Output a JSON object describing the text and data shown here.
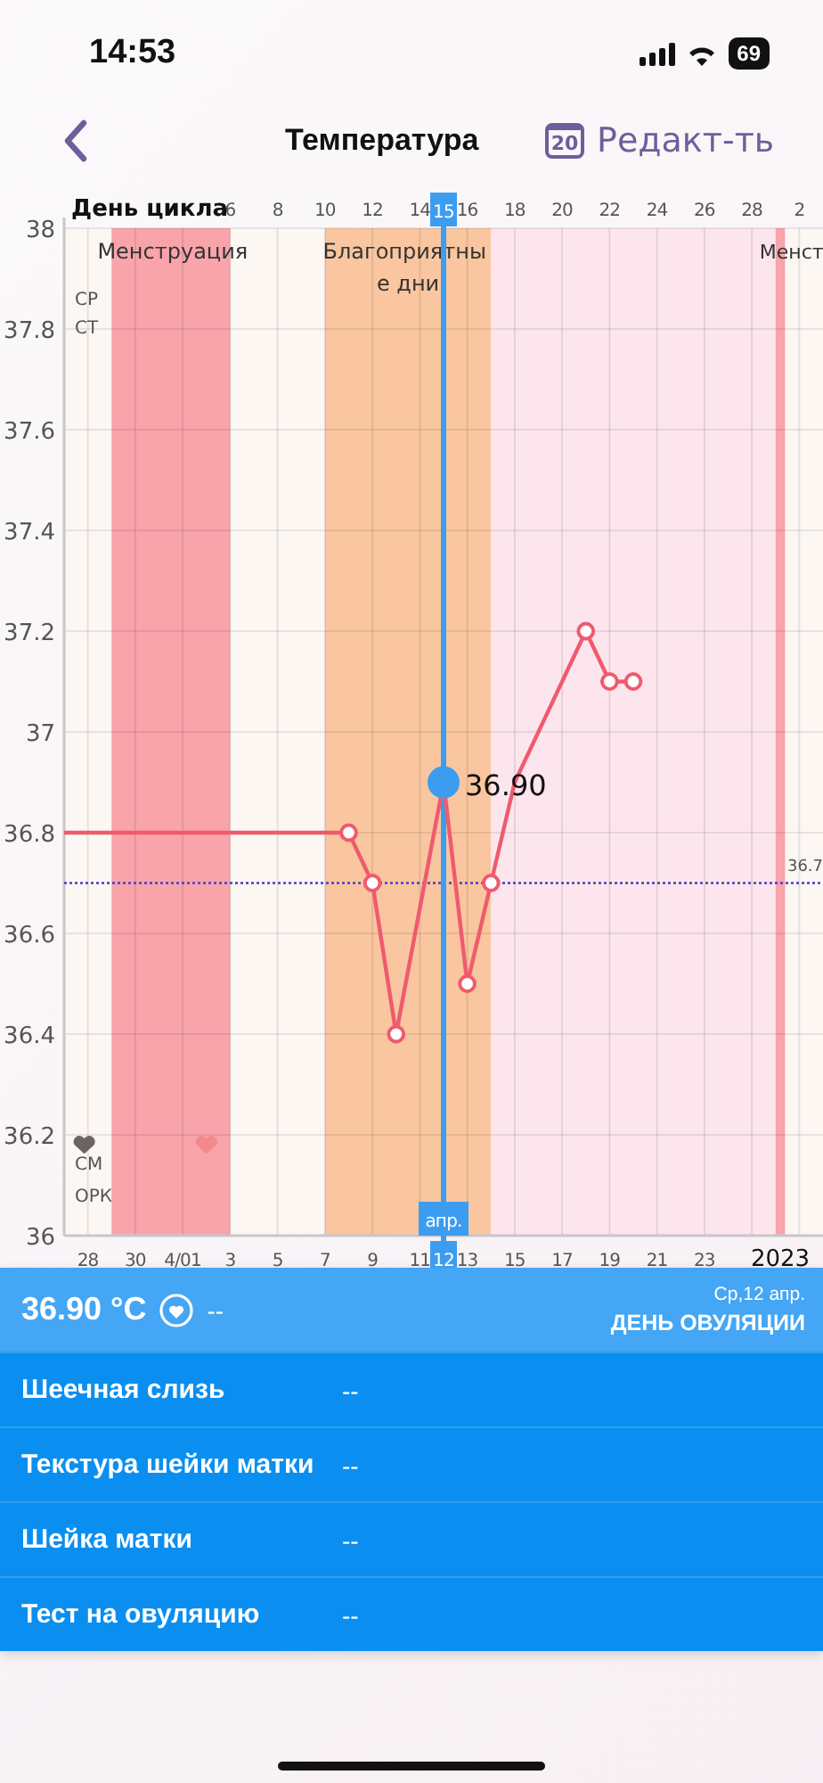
{
  "status_bar": {
    "time": "14:53",
    "battery": "69"
  },
  "nav": {
    "title": "Температура",
    "calendar_day": "20",
    "edit_label": "Редакт-ть"
  },
  "chart": {
    "chart_data": {
      "type": "line",
      "x": [
        -4,
        8,
        9,
        10,
        12,
        13,
        14,
        15,
        18,
        19,
        20
      ],
      "series": [
        {
          "color": "#ef5b6e",
          "marker": "o",
          "values": [
            36.8,
            36.8,
            36.7,
            36.4,
            36.9,
            36.5,
            36.7,
            36.9,
            37.2,
            37.1,
            37.1
          ]
        }
      ],
      "xlim": [
        -4,
        28
      ],
      "ylim": [
        36,
        38
      ],
      "xticks": [
        3,
        5,
        7,
        9,
        11,
        12,
        13,
        15,
        17,
        19,
        21,
        23
      ],
      "bands": [
        {
          "axis": "x",
          "from": -2,
          "to": 3,
          "label": "Менструация",
          "color": "#f8a4aa"
        },
        {
          "axis": "x",
          "from": 7,
          "to": 14,
          "label": "Благоприятны е дни",
          "color": "#f9c69f"
        },
        {
          "axis": "x",
          "from": 14,
          "to": 26,
          "color": "#fde5ee"
        },
        {
          "axis": "x",
          "from": 26,
          "to": 26.4,
          "label": "Менст",
          "color": "#f8a4aa"
        }
      ],
      "yticks": [
        36,
        36.2,
        36.4,
        36.6,
        36.8,
        37,
        37.2,
        37.4,
        37.6,
        37.8,
        38
      ],
      "grid": true,
      "ref_lines": [
        {
          "axis": "y",
          "value": 36.7,
          "label": "36.7",
          "color": "#4a3cc2"
        },
        {
          "axis": "x",
          "value": 12,
          "color": "#3c9df0"
        }
      ],
      "annotations": [
        {
          "text": "36.90",
          "x": 12,
          "y": 36.9
        }
      ]
    },
    "earlier_date_labels": [
      "28",
      "30",
      "4/01"
    ],
    "top_axis": {
      "title": "День цикла",
      "ticks": [
        {
          "label": "6",
          "selected": false
        },
        {
          "label": "8",
          "selected": false
        },
        {
          "label": "10",
          "selected": false
        },
        {
          "label": "12",
          "selected": false
        },
        {
          "label": "14",
          "selected": false
        },
        {
          "label": "15",
          "selected": true
        },
        {
          "label": "16",
          "selected": false
        },
        {
          "label": "18",
          "selected": false
        },
        {
          "label": "20",
          "selected": false
        },
        {
          "label": "22",
          "selected": false
        },
        {
          "label": "24",
          "selected": false
        },
        {
          "label": "26",
          "selected": false
        },
        {
          "label": "28",
          "selected": false
        },
        {
          "label": "2",
          "selected": false
        }
      ]
    },
    "month_tag": "апр.",
    "year_label": "2023",
    "top_side_labels": [
      "СР",
      "СТ"
    ],
    "bottom_side_labels": [
      "СМ",
      "ОРК"
    ],
    "hearts": [
      {
        "color": "#6b6464"
      },
      {
        "color": "#f2898c"
      }
    ]
  },
  "summary": {
    "temperature": "36.90 °C",
    "note": "--",
    "date": "Ср,12 апр.",
    "day_type": "ДЕНЬ ОВУЛЯЦИИ"
  },
  "fields": [
    {
      "label": "Шеечная слизь",
      "value": "--"
    },
    {
      "label": "Текстура шейки матки",
      "value": "--"
    },
    {
      "label": "Шейка матки",
      "value": "--"
    },
    {
      "label": "Тест на овуляцию",
      "value": "--"
    }
  ]
}
